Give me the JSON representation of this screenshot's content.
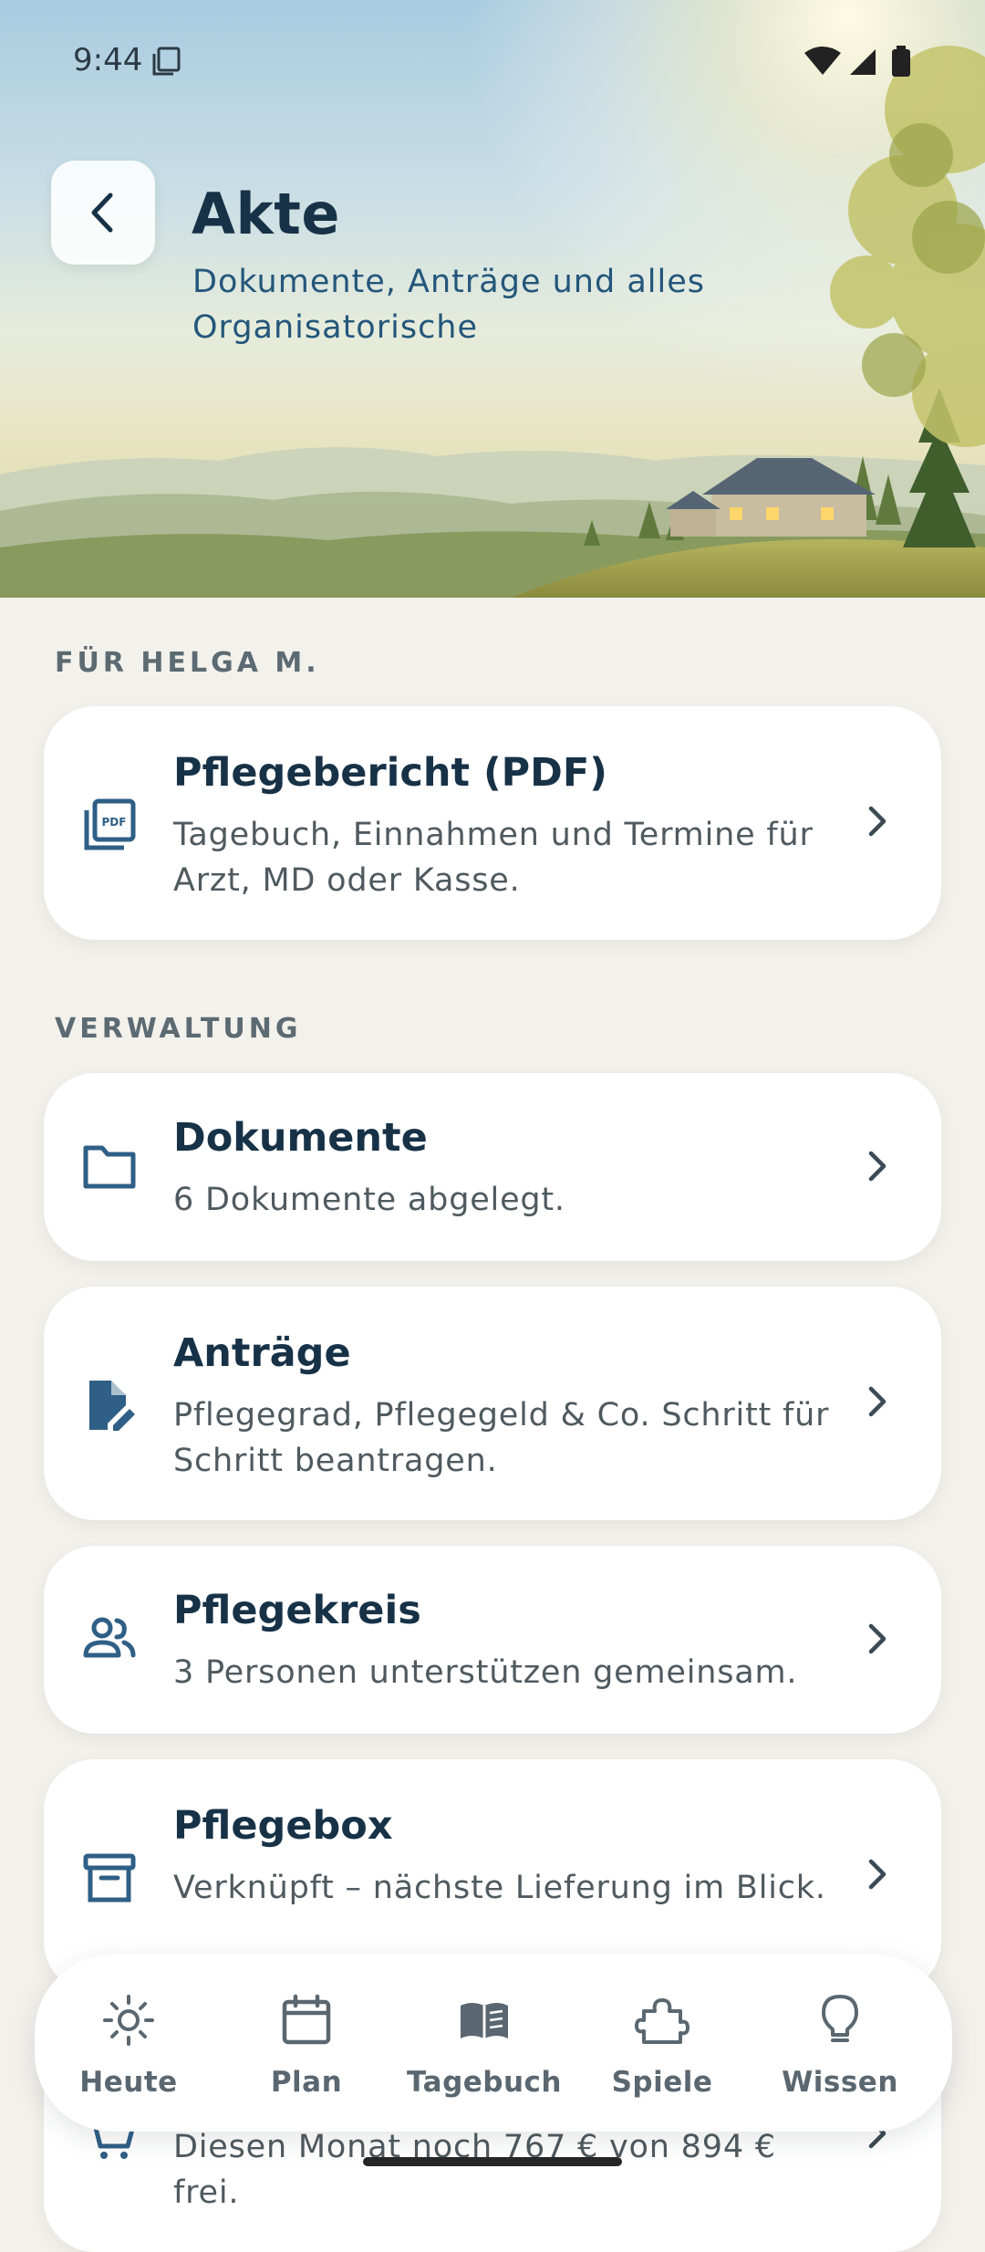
{
  "status_bar": {
    "time": "9:44"
  },
  "header": {
    "title": "Akte",
    "subtitle": "Dokumente, Anträge und alles Organisatorische"
  },
  "sections": [
    {
      "label": "FÜR HELGA M.",
      "cards": [
        {
          "title": "Pflegebericht (PDF)",
          "description": "Tagebuch, Einnahmen und Termine für Arzt, MD oder Kasse.",
          "icon": "pdf-icon"
        }
      ]
    },
    {
      "label": "VERWALTUNG",
      "cards": [
        {
          "title": "Dokumente",
          "description": "6 Dokumente abgelegt.",
          "icon": "folder-icon"
        },
        {
          "title": "Anträge",
          "description": "Pflegegrad, Pflegegeld & Co. Schritt für Schritt beantragen.",
          "icon": "document-edit-icon"
        },
        {
          "title": "Pflegekreis",
          "description": "3 Personen unterstützen gemeinsam.",
          "icon": "people-icon"
        },
        {
          "title": "Pflegebox",
          "description": "Verknüpft – nächste Lieferung im Blick.",
          "icon": "archive-box-icon"
        },
        {
          "title": "",
          "description": "Diesen Monat noch 767 € von 894 € frei.",
          "icon": "cart-icon"
        }
      ]
    }
  ],
  "bottom_nav": {
    "items": [
      {
        "label": "Heute",
        "icon": "sun-icon"
      },
      {
        "label": "Plan",
        "icon": "calendar-icon"
      },
      {
        "label": "Tagebuch",
        "icon": "book-icon"
      },
      {
        "label": "Spiele",
        "icon": "puzzle-icon"
      },
      {
        "label": "Wissen",
        "icon": "lightbulb-icon"
      }
    ]
  },
  "colors": {
    "primary_text": "#173247",
    "icon_blue": "#2f5f86",
    "background": "#f3f1ec",
    "card": "#ffffff"
  }
}
